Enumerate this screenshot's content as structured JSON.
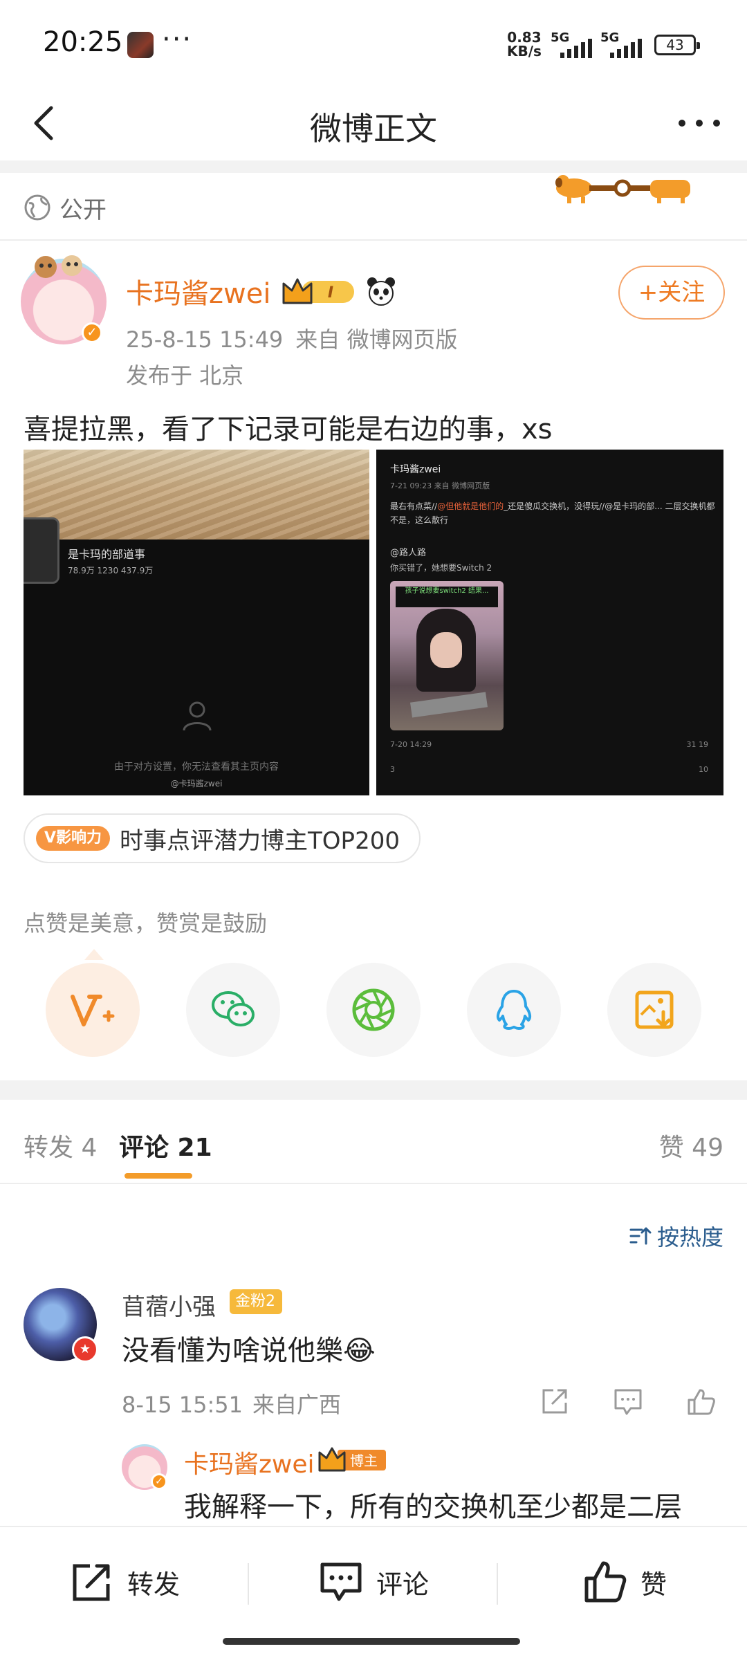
{
  "status_bar": {
    "time": "20:25",
    "dots": "···",
    "net_speed_value": "0.83",
    "net_speed_unit": "KB/s",
    "signal1_label": "5G",
    "signal2_label": "5G",
    "battery": "43"
  },
  "nav": {
    "title": "微博正文"
  },
  "post": {
    "privacy": "公开",
    "author_name": "卡玛酱zwei",
    "level_badge": "I",
    "follow_label": "+关注",
    "time": "25-8-15 15:49",
    "source": "来自 微博网页版",
    "location": "发布于 北京",
    "text": "喜提拉黑，看了下记录可能是右边的事，xs",
    "influence_badge": "V影响力",
    "influence_text": "时事点评潜力博主TOP200",
    "like_hint": "点赞是美意，赞赏是鼓励"
  },
  "image1": {
    "profile_name": "是卡玛的部道事",
    "profile_stats": "78.9万    1230    437.9万",
    "blocked_text": "由于对方设置，你无法查看其主页内容",
    "watermark": "@卡玛酱zwei"
  },
  "image2": {
    "header": "卡玛酱zwei",
    "sub": "7-21 09:23 来自 微博网页版",
    "body_lead": "最右有点菜//",
    "body_highlight": "@但他就是他们的",
    "body_rest": "_还是傻瓜交换机，没得玩//@是卡玛的部... 二层交换机都不是，这么散行",
    "quote_user": "@路人路",
    "quote_text": "你买错了，她想要Switch 2",
    "photo_caption": "孩子说想要switch2 结果...",
    "foot_left": "7-20 14:29",
    "foot_right": "31   19",
    "foot2_left": "3",
    "foot2_right": "10"
  },
  "tabs": {
    "repost": "转发 4",
    "comment": "评论 21",
    "likes": "赞 49"
  },
  "sort": {
    "label": "按热度"
  },
  "comment": {
    "name": "苜蓿小强",
    "fan_badge": "金粉2",
    "text": "没看懂为啥说他樂😂",
    "time": "8-15 15:51",
    "source": "来自广西"
  },
  "reply": {
    "name": "卡玛酱zwei",
    "badge": "博主",
    "text": "我解释一下，所有的交换机至少都是二层"
  },
  "bottom_bar": {
    "repost": "转发",
    "comment": "评论",
    "like": "赞"
  },
  "colors": {
    "accent_orange": "#e8721f",
    "link_blue": "#2b5d8e",
    "tab_underline": "#f39c2a"
  }
}
